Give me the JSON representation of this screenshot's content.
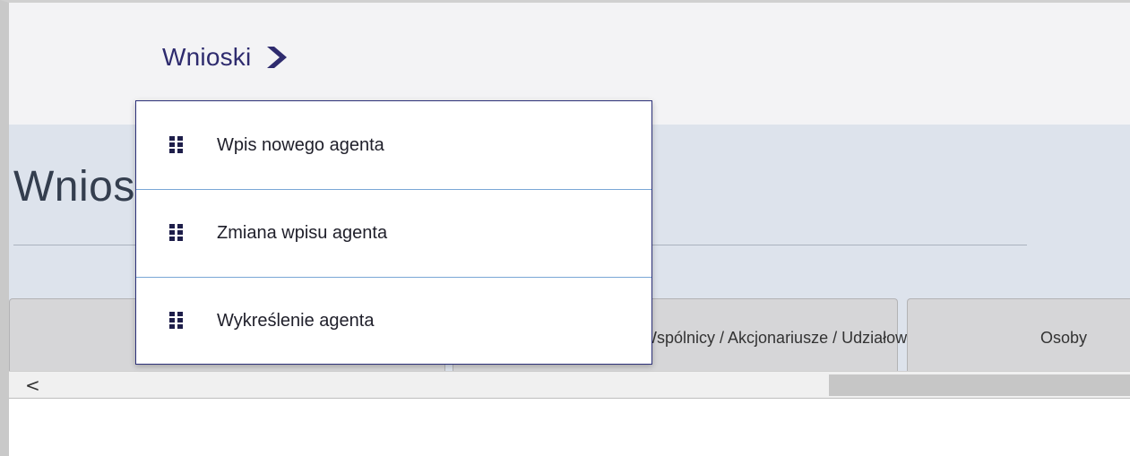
{
  "nav": {
    "menu_label": "Wnioski",
    "chevron_icon": "chevron-right-icon",
    "accent_color": "#2e2b6e"
  },
  "page": {
    "title": "Wniosek o zmianę wpisu agenta"
  },
  "tabs": [
    {
      "label": ""
    },
    {
      "label": "Wspólnicy / Akcjonariusze / Udziałowcy"
    },
    {
      "label": "Osoby"
    }
  ],
  "scrollbar": {
    "left_arrow": "<"
  },
  "dropdown": {
    "border_color": "#2d3179",
    "item_icon": "grid-icon",
    "items": [
      {
        "label": "Wpis nowego agenta"
      },
      {
        "label": "Zmiana wpisu agenta"
      },
      {
        "label": "Wykreślenie agenta"
      }
    ]
  }
}
